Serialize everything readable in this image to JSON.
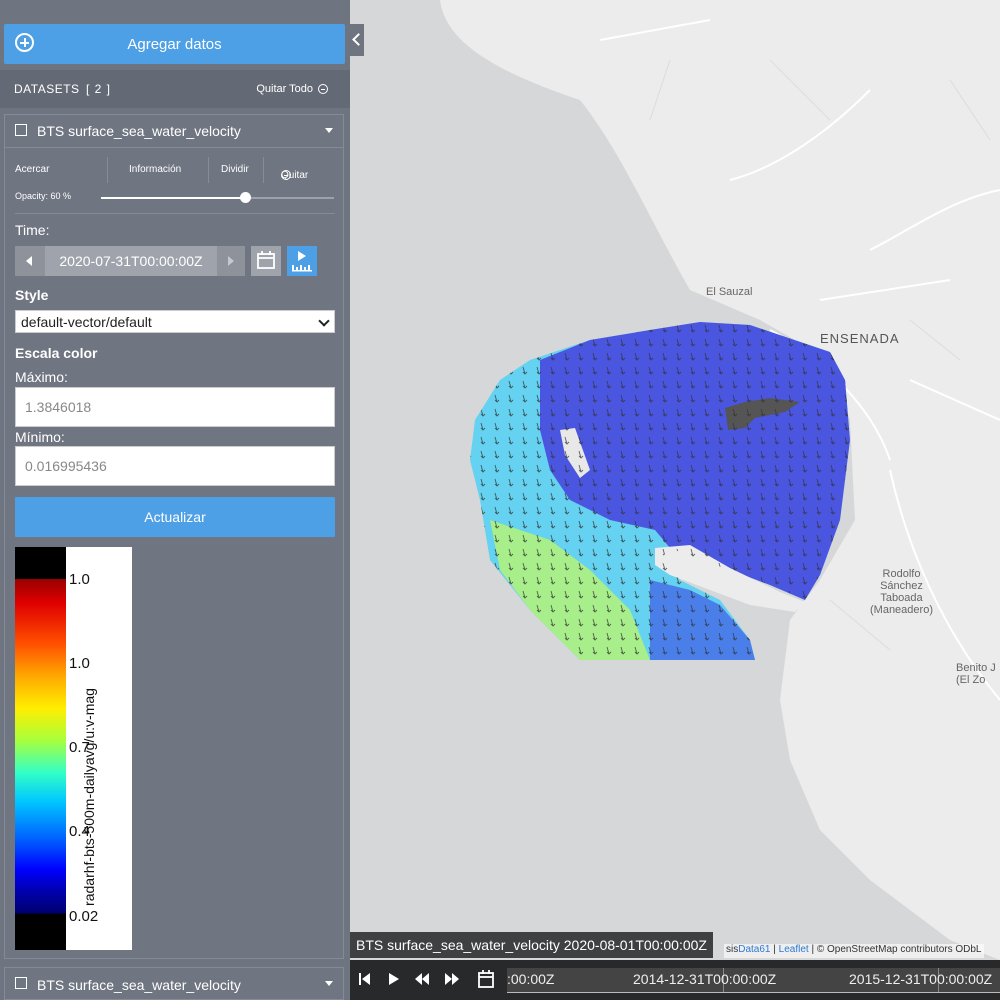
{
  "sidebar": {
    "add_button": "Agregar datos",
    "datasets_title": "DATASETS",
    "datasets_count": "[ 2 ]",
    "clear_all": "Quitar Todo",
    "dataset": {
      "name": "BTS surface_sea_water_velocity",
      "actions": {
        "zoom": "Acercar",
        "info": "Información",
        "split": "Dividir",
        "remove": "Quitar"
      },
      "opacity_label": "Opacity: 60 %",
      "opacity": 0.6,
      "time_label": "Time:",
      "time_value": "2020-07-31T00:00:00Z",
      "style_label": "Style",
      "style_value": "default-vector/default",
      "color_scale_label": "Escala color",
      "max_label": "Máximo:",
      "max_placeholder": "1.3846018",
      "min_label": "Mínimo:",
      "min_placeholder": "0.016995436",
      "update_button": "Actualizar",
      "legend": {
        "ticks": [
          "1.0",
          "1.0",
          "0.7",
          "0.4",
          "0.02"
        ],
        "label": "radarhf-bts-500m-dailyavg/u:v-mag"
      }
    },
    "dataset2": {
      "name": "BTS surface_sea_water_velocity"
    }
  },
  "map": {
    "places": {
      "sauzal": "El Sauzal",
      "ensenada": "ENSENADA",
      "rodolfo": [
        "Rodolfo",
        "Sánchez",
        "Taboada",
        "(Maneadero)"
      ],
      "benito": [
        "Benito J",
        "(El Zo"
      ]
    },
    "caption": "BTS surface_sea_water_velocity 2020-08-01T00:00:00Z",
    "attribution": {
      "pre": "sis",
      "data61": "Data61",
      "sep1": " | ",
      "leaflet": "Leaflet",
      "osm": " | © OpenStreetMap contributors ODbL"
    }
  },
  "timeline": {
    "labels": [
      ":00:00Z",
      "2014-12-31T00:00:00Z",
      "2015-12-31T00:00:00Z"
    ]
  },
  "colors": {
    "accent": "#4d9fe6",
    "sidebar": "#6e7480",
    "sea": "#d6d7d9",
    "land": "#ececec",
    "current_high": "#4a56e0"
  }
}
